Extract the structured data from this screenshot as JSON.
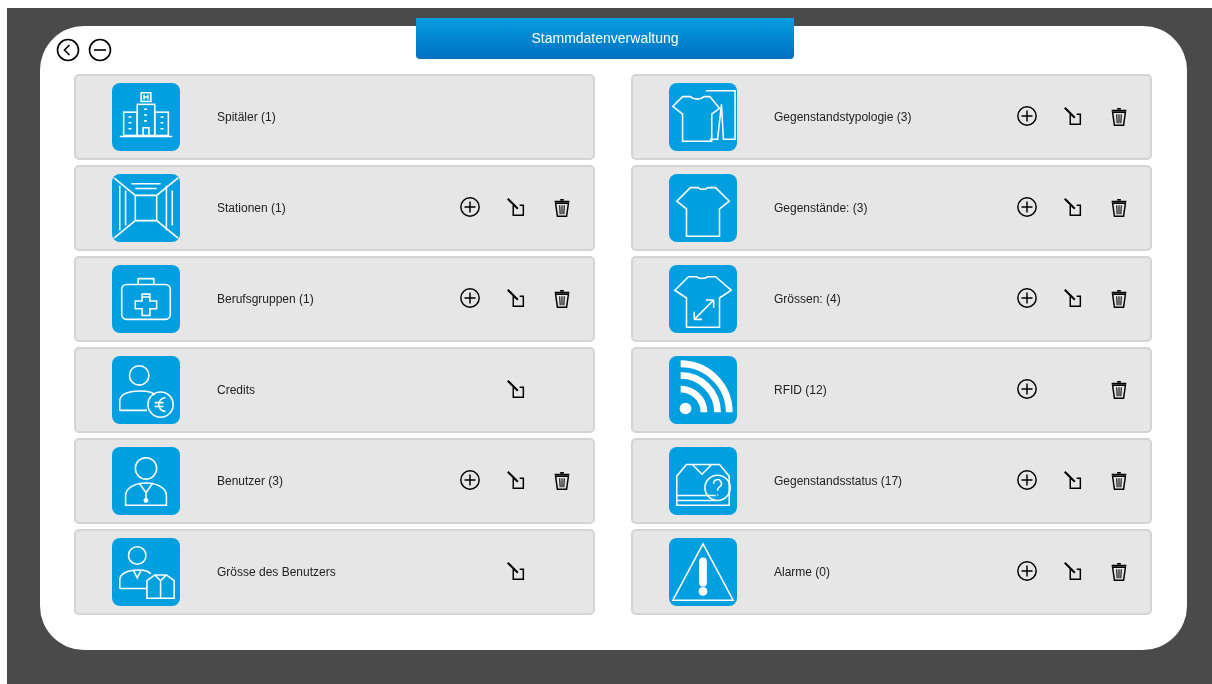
{
  "header": {
    "title": "Stammdatenverwaltung"
  },
  "columns": [
    {
      "items": [
        {
          "label": "Spitäler (1)",
          "add": false,
          "edit": false,
          "delete": false
        },
        {
          "label": "Stationen (1)",
          "add": true,
          "edit": true,
          "delete": true
        },
        {
          "label": "Berufsgruppen (1)",
          "add": true,
          "edit": true,
          "delete": true
        },
        {
          "label": "Credits",
          "add": false,
          "edit": true,
          "delete": false
        },
        {
          "label": "Benutzer (3)",
          "add": true,
          "edit": true,
          "delete": true
        },
        {
          "label": "Grösse des Benutzers",
          "add": false,
          "edit": true,
          "delete": false
        }
      ]
    },
    {
      "items": [
        {
          "label": "Gegenstandstypologie (3)",
          "add": true,
          "edit": true,
          "delete": true
        },
        {
          "label": "Gegenstände: (3)",
          "add": true,
          "edit": true,
          "delete": true
        },
        {
          "label": "Grössen: (4)",
          "add": true,
          "edit": true,
          "delete": true
        },
        {
          "label": "RFID (12)",
          "add": true,
          "edit": false,
          "delete": true
        },
        {
          "label": "Gegenstandsstatus (17)",
          "add": true,
          "edit": true,
          "delete": true
        },
        {
          "label": "Alarme (0)",
          "add": true,
          "edit": true,
          "delete": true
        }
      ]
    }
  ]
}
